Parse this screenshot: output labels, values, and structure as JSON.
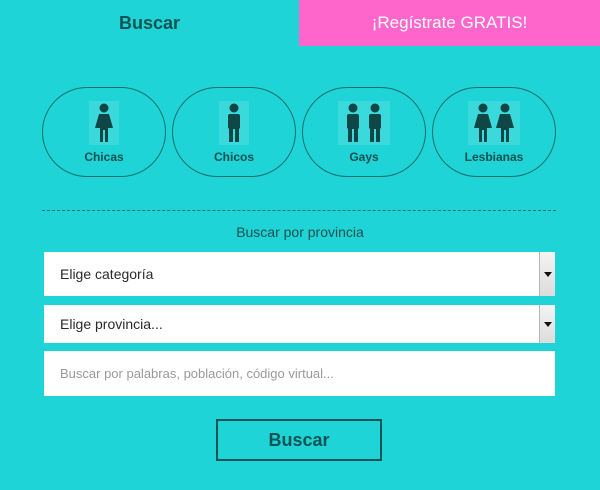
{
  "tabs": {
    "search_label": "Buscar",
    "register_label": "¡Regístrate GRATIS!"
  },
  "categories": [
    {
      "label": "Chicas",
      "icon": "woman-icon"
    },
    {
      "label": "Chicos",
      "icon": "man-icon"
    },
    {
      "label": "Gays",
      "icon": "two-men-icon"
    },
    {
      "label": "Lesbianas",
      "icon": "two-women-icon"
    }
  ],
  "filters": {
    "province_heading": "Buscar por provincia",
    "category_select_value": "Elige categoría",
    "province_select_value": "Elige provincia...",
    "search_placeholder": "Buscar por palabras, población, código virtual..."
  },
  "submit_label": "Buscar",
  "colors": {
    "background": "#1fd4d6",
    "accent_pink": "#ff66cc",
    "dark_teal": "#0f5454"
  }
}
